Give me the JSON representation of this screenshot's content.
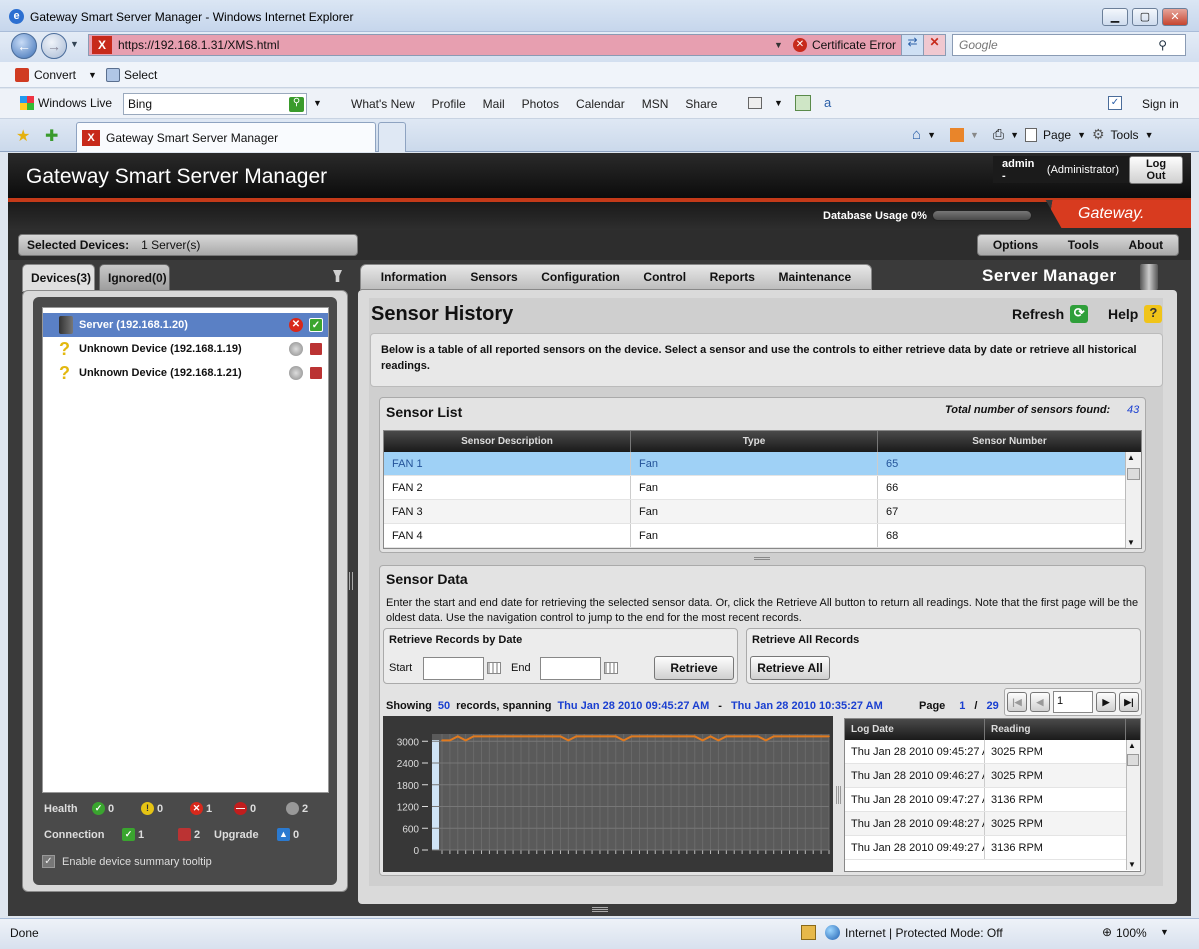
{
  "browser": {
    "window_title": "Gateway Smart Server Manager - Windows Internet Explorer",
    "url": "https://192.168.1.31/XMS.html",
    "certificate_error": "Certificate Error",
    "search_placeholder": "Google",
    "convert": "Convert",
    "select": "Select",
    "windows_live": "Windows Live",
    "bing_value": "Bing",
    "links": [
      "What's New",
      "Profile",
      "Mail",
      "Photos",
      "Calendar",
      "MSN",
      "Share"
    ],
    "sign_in": "Sign in",
    "tab_title": "Gateway Smart Server Manager",
    "page_menu": "Page",
    "tools_menu": "Tools",
    "status_done": "Done",
    "zone": "Internet | Protected Mode: Off",
    "zoom": "100%"
  },
  "app": {
    "title": "Gateway Smart Server Manager",
    "user": "admin -",
    "role": "(Administrator)",
    "logout": "Log Out",
    "db_usage": "Database Usage 0%",
    "db_usage_fraction": 0,
    "logo": "Gateway.",
    "selected_label": "Selected Devices:",
    "selected_value": "1 Server(s)",
    "top_menu": [
      "Options",
      "Tools",
      "About"
    ],
    "brand": "Server Manager"
  },
  "left": {
    "tab_devices": "Devices(3)",
    "tab_ignored": "Ignored(0)",
    "devices": [
      {
        "label": "Server (192.168.1.20)"
      },
      {
        "label": "Unknown Device (192.168.1.19)"
      },
      {
        "label": "Unknown Device (192.168.1.21)"
      }
    ],
    "health_label": "Health",
    "health_counts": [
      "0",
      "0",
      "1",
      "0",
      "2"
    ],
    "connection_label": "Connection",
    "connection_counts": [
      "1",
      "2"
    ],
    "upgrade_label": "Upgrade",
    "upgrade_count": "0",
    "tooltip_option": "Enable device summary tooltip"
  },
  "main": {
    "tabs": [
      "Information",
      "Sensors",
      "Configuration",
      "Control",
      "Reports",
      "Maintenance"
    ],
    "heading": "Sensor History",
    "refresh": "Refresh",
    "help": "Help",
    "description": "Below is a table of all reported sensors on the device.  Select a sensor and use the controls to either retrieve data by date or retrieve all historical readings.",
    "sensor_list": {
      "title": "Sensor List",
      "total_label": "Total number of sensors found:",
      "total_value": "43",
      "columns": [
        "Sensor Description",
        "Type",
        "Sensor Number"
      ],
      "rows": [
        [
          "FAN 1",
          "Fan",
          "65"
        ],
        [
          "FAN 2",
          "Fan",
          "66"
        ],
        [
          "FAN 3",
          "Fan",
          "67"
        ],
        [
          "FAN 4",
          "Fan",
          "68"
        ]
      ]
    },
    "sensor_data": {
      "title": "Sensor Data",
      "instructions": "Enter the start and end date for retrieving the selected sensor data.  Or, click the Retrieve All button to return all readings.  Note that the first page will be the oldest data.  Use the navigation control to jump to the end for the most recent records.",
      "by_date_title": "Retrieve Records by Date",
      "start_label": "Start",
      "end_label": "End",
      "retrieve": "Retrieve",
      "all_title": "Retrieve All Records",
      "retrieve_all": "Retrieve All",
      "showing": "Showing",
      "count": "50",
      "records_spanning": "records, spanning",
      "range_start": "Thu Jan 28 2010 09:45:27 AM",
      "dash": "-",
      "range_end": "Thu Jan 28 2010 10:35:27 AM",
      "page_label": "Page",
      "page_current": "1",
      "page_sep": "/",
      "page_total": "29",
      "page_input": "1",
      "log_columns": [
        "Log Date",
        "Reading"
      ],
      "log_rows": [
        [
          "Thu Jan 28 2010 09:45:27 A",
          "3025 RPM"
        ],
        [
          "Thu Jan 28 2010 09:46:27 A",
          "3025 RPM"
        ],
        [
          "Thu Jan 28 2010 09:47:27 A",
          "3136 RPM"
        ],
        [
          "Thu Jan 28 2010 09:48:27 A",
          "3025 RPM"
        ],
        [
          "Thu Jan 28 2010 09:49:27 A",
          "3136 RPM"
        ]
      ]
    }
  },
  "chart_data": {
    "type": "line",
    "ylim": [
      0,
      3200
    ],
    "yticks": [
      "3000",
      "2400",
      "1800",
      "1200",
      "600",
      "0"
    ],
    "line_color": "#e07a1f",
    "series": [
      {
        "values": [
          3025,
          3025,
          3136,
          3025,
          3136,
          3136,
          3136,
          3136,
          3136,
          3136,
          3136,
          3136,
          3136,
          3136,
          3136,
          3136,
          3025,
          3136,
          3136,
          3136,
          3136,
          3136,
          3136,
          3025,
          3136,
          3136,
          3136,
          3136,
          3136,
          3136,
          3136,
          3136,
          3136,
          3025,
          3136,
          3025,
          3136,
          3136,
          3136,
          3136,
          3136,
          3025,
          3136,
          3136,
          3136,
          3136,
          3136,
          3136,
          3136,
          3136
        ]
      }
    ]
  }
}
